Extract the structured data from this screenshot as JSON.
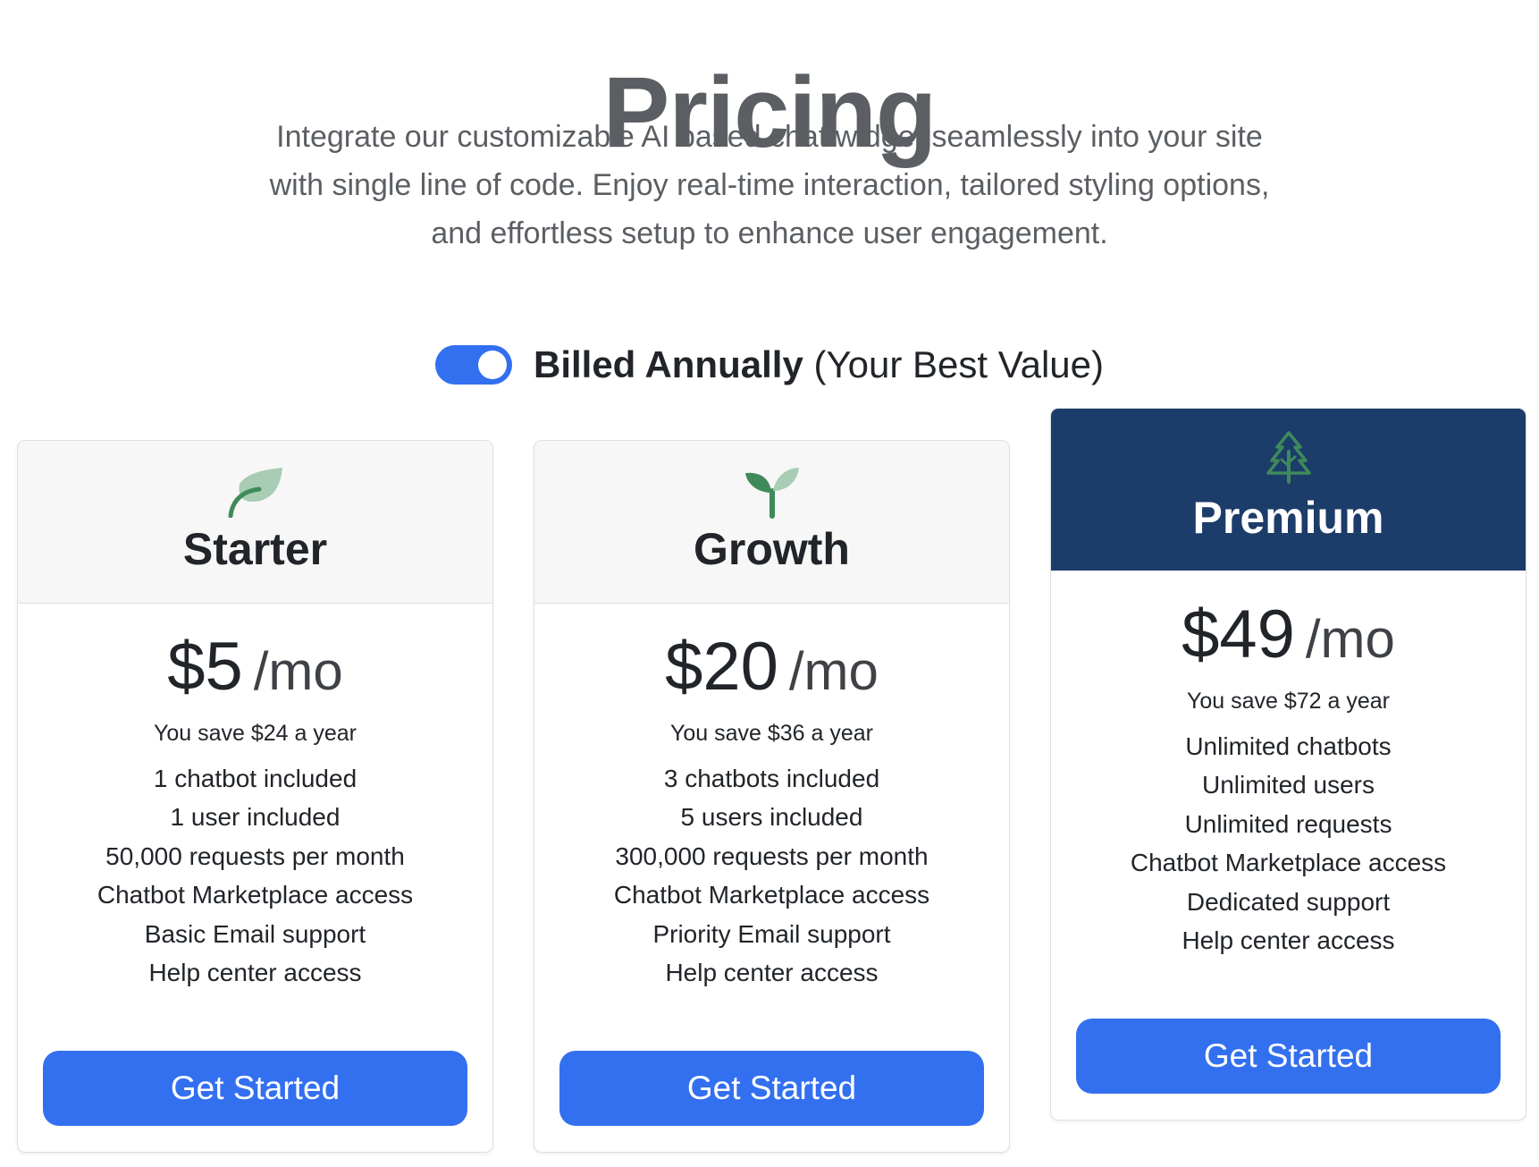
{
  "header": {
    "title": "Pricing",
    "subtitle_lines": [
      "Integrate our customizable AI based chat widget seamlessly into your site",
      "with single line of code. Enjoy real-time interaction, tailored styling options,",
      "and effortless setup to enhance user engagement."
    ]
  },
  "billing": {
    "toggle_on": true,
    "label_bold": "Billed Annually",
    "label_note": "(Your Best Value)"
  },
  "colors": {
    "accent": "#3370f0",
    "premium_header": "#1c3c6a",
    "icon_green": "#3f8a5a",
    "icon_light_green": "#a9cdb4"
  },
  "plans": [
    {
      "icon": "leaf-icon",
      "name": "Starter",
      "price": "$5",
      "per": "/mo",
      "savings": "You save $24 a year",
      "features": [
        "1 chatbot included",
        "1 user included",
        "50,000 requests per month",
        "Chatbot Marketplace access",
        "Basic Email support",
        "Help center access"
      ],
      "cta": "Get Started"
    },
    {
      "icon": "sprout-icon",
      "name": "Growth",
      "price": "$20",
      "per": "/mo",
      "savings": "You save $36 a year",
      "features": [
        "3 chatbots included",
        "5 users included",
        "300,000 requests per month",
        "Chatbot Marketplace access",
        "Priority Email support",
        "Help center access"
      ],
      "cta": "Get Started"
    },
    {
      "icon": "tree-icon",
      "name": "Premium",
      "price": "$49",
      "per": "/mo",
      "savings": "You save $72 a year",
      "features": [
        "Unlimited chatbots",
        "Unlimited users",
        "Unlimited requests",
        "Chatbot Marketplace access",
        "Dedicated support",
        "Help center access"
      ],
      "cta": "Get Started"
    }
  ]
}
